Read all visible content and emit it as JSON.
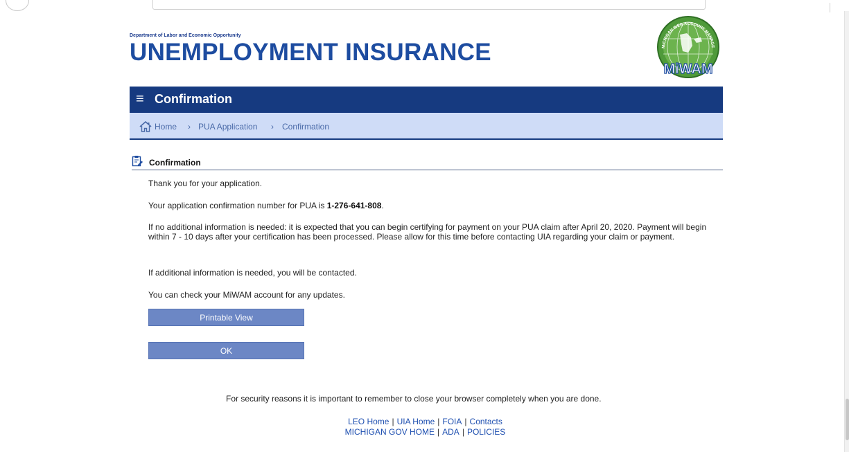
{
  "header": {
    "department": "Department of Labor and Economic Opportunity",
    "title": "UNEMPLOYMENT INSURANCE",
    "logo": {
      "text": "MiWAM",
      "arc_text": "MICHIGAN WEB ACCOUNT MANAGER",
      "colors": {
        "primary": "#1d4ca0",
        "green": "#4f9a3a"
      }
    }
  },
  "nav": {
    "menu_icon": "≡",
    "title": "Confirmation"
  },
  "breadcrumb": {
    "items": [
      "Home",
      "PUA Application",
      "Confirmation"
    ],
    "separator": "›"
  },
  "section": {
    "title": "Confirmation"
  },
  "content": {
    "thanks": "Thank you for your application.",
    "confirmation_prefix": "Your application confirmation number for PUA is ",
    "confirmation_number": "1-276-641-808",
    "confirmation_suffix": ".",
    "certify_info": "If no additional information is needed: it is expected that you can begin certifying for payment on your PUA claim after April 20, 2020. Payment will begin within 7 - 10 days after your certification has been processed. Please allow for this time before contacting UIA regarding your claim or payment.",
    "contact_info": "If additional information is needed, you will be contacted.",
    "updates_info": "You can check your MiWAM account for any updates."
  },
  "buttons": {
    "printable_view": "Printable View",
    "ok": "OK"
  },
  "security_note": "For security reasons it is important to remember to close your browser completely when you are done.",
  "footer": {
    "row1": [
      "LEO Home",
      "UIA Home",
      "FOIA",
      "Contacts"
    ],
    "row2": [
      "MICHIGAN GOV HOME",
      "ADA",
      "POLICIES"
    ],
    "separator": "|"
  },
  "icons": {
    "menu": "hamburger-menu-icon",
    "home": "home-icon",
    "section": "clipboard-edit-icon"
  }
}
